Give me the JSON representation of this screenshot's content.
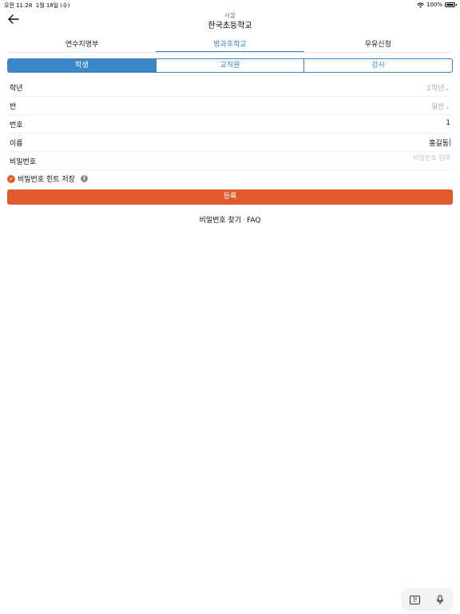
{
  "status_bar": {
    "time": "오전 11:28",
    "date": "1월 18일 (수)",
    "battery": "100%"
  },
  "header": {
    "back_icon": "arrow-left-icon",
    "region": "서울",
    "school": "한국초등학교"
  },
  "top_tabs": [
    {
      "label": "연수지명부",
      "active": false
    },
    {
      "label": "방과후학교",
      "active": true
    },
    {
      "label": "우유신청",
      "active": false
    }
  ],
  "segments": [
    {
      "label": "학생",
      "active": true
    },
    {
      "label": "교직원",
      "active": false
    },
    {
      "label": "강사",
      "active": false
    }
  ],
  "form": {
    "grade": {
      "label": "학년",
      "value": "1학년"
    },
    "class": {
      "label": "반",
      "value": "일반"
    },
    "number": {
      "label": "번호",
      "value": "1"
    },
    "name": {
      "label": "이름",
      "value": "홍길동"
    },
    "password": {
      "label": "비밀번호",
      "placeholder": "비밀번호 입력"
    }
  },
  "hint": {
    "label": "비밀번호 힌트 저장",
    "checked": true
  },
  "register_label": "등록",
  "links": {
    "find_password": "비밀번호 찾기",
    "separator": "·",
    "faq": "FAQ"
  },
  "keyboard": {
    "lang_key": "한",
    "mic_icon": "microphone-icon"
  },
  "colors": {
    "accent": "#3b86c6",
    "primary": "#e05a2b"
  }
}
